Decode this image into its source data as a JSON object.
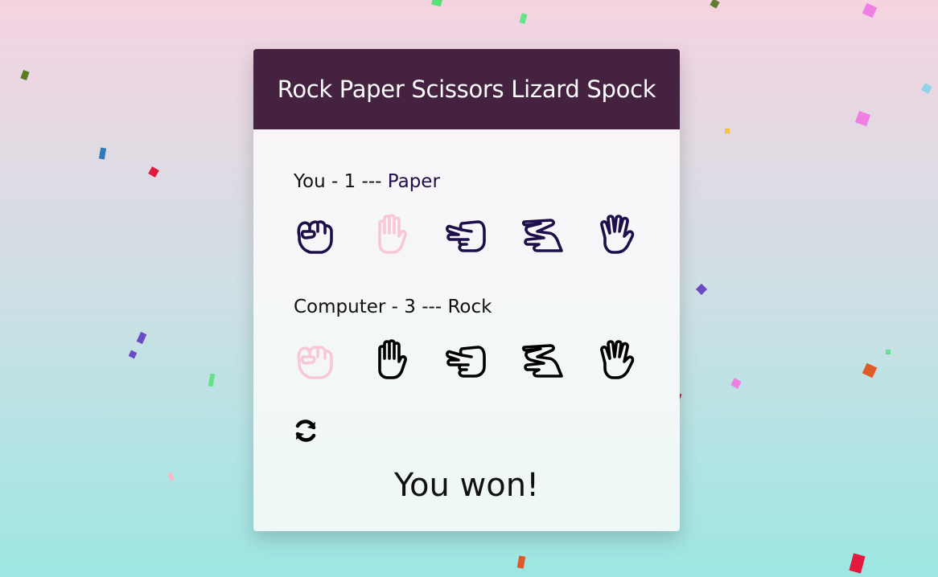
{
  "game": {
    "title": "Rock Paper Scissors Lizard Spock",
    "result": "You won!"
  },
  "player": {
    "label": "You",
    "score": "1",
    "separator": "---",
    "choice": "Paper",
    "hands": [
      {
        "name": "rock",
        "icon": "rock-icon",
        "selected": false
      },
      {
        "name": "paper",
        "icon": "paper-icon",
        "selected": true
      },
      {
        "name": "scissors",
        "icon": "scissors-icon",
        "selected": false
      },
      {
        "name": "lizard",
        "icon": "lizard-icon",
        "selected": false
      },
      {
        "name": "spock",
        "icon": "spock-icon",
        "selected": false
      }
    ]
  },
  "computer": {
    "label": "Computer",
    "score": "3",
    "separator": "---",
    "choice": "Rock",
    "hands": [
      {
        "name": "rock",
        "icon": "rock-icon",
        "selected": true
      },
      {
        "name": "paper",
        "icon": "paper-icon",
        "selected": false
      },
      {
        "name": "scissors",
        "icon": "scissors-icon",
        "selected": false
      },
      {
        "name": "lizard",
        "icon": "lizard-icon",
        "selected": false
      },
      {
        "name": "spock",
        "icon": "spock-icon",
        "selected": false
      }
    ]
  },
  "controls": {
    "reset_icon": "refresh-icon"
  },
  "colors": {
    "header_bg": "#452240",
    "player_hand": "#1e0f4a",
    "computer_hand": "#000000",
    "selected_hand": "#f8c8d8"
  }
}
